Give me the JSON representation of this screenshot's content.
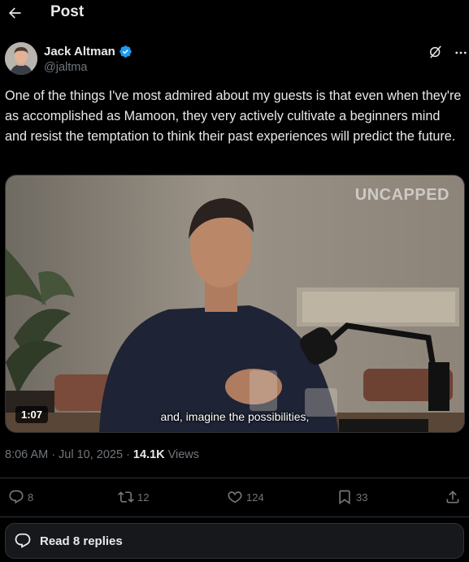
{
  "header": {
    "title": "Post"
  },
  "author": {
    "display_name": "Jack Altman",
    "handle": "@jaltma",
    "verified": true
  },
  "post": {
    "text": "One of the things I've most admired about my guests is that even when they're as accomplished as Mamoon, they very actively cultivate a beginners mind and resist the temptation to think their past experiences will predict the future."
  },
  "video": {
    "watermark": "UNCAPPED",
    "subtitle": "and, imagine the possibilities,",
    "duration": "1:07"
  },
  "meta": {
    "time": "8:06 AM",
    "separator": "·",
    "date": "Jul 10, 2025",
    "views_count": "14.1K",
    "views_label": "Views"
  },
  "actions": {
    "replies": "8",
    "reposts": "12",
    "likes": "124",
    "bookmarks": "33"
  },
  "read_replies": {
    "label": "Read 8 replies"
  },
  "colors": {
    "background": "#000000",
    "text_primary": "#e7e9ea",
    "text_secondary": "#71767b",
    "verified": "#1d9bf0",
    "border": "#2f3336"
  }
}
